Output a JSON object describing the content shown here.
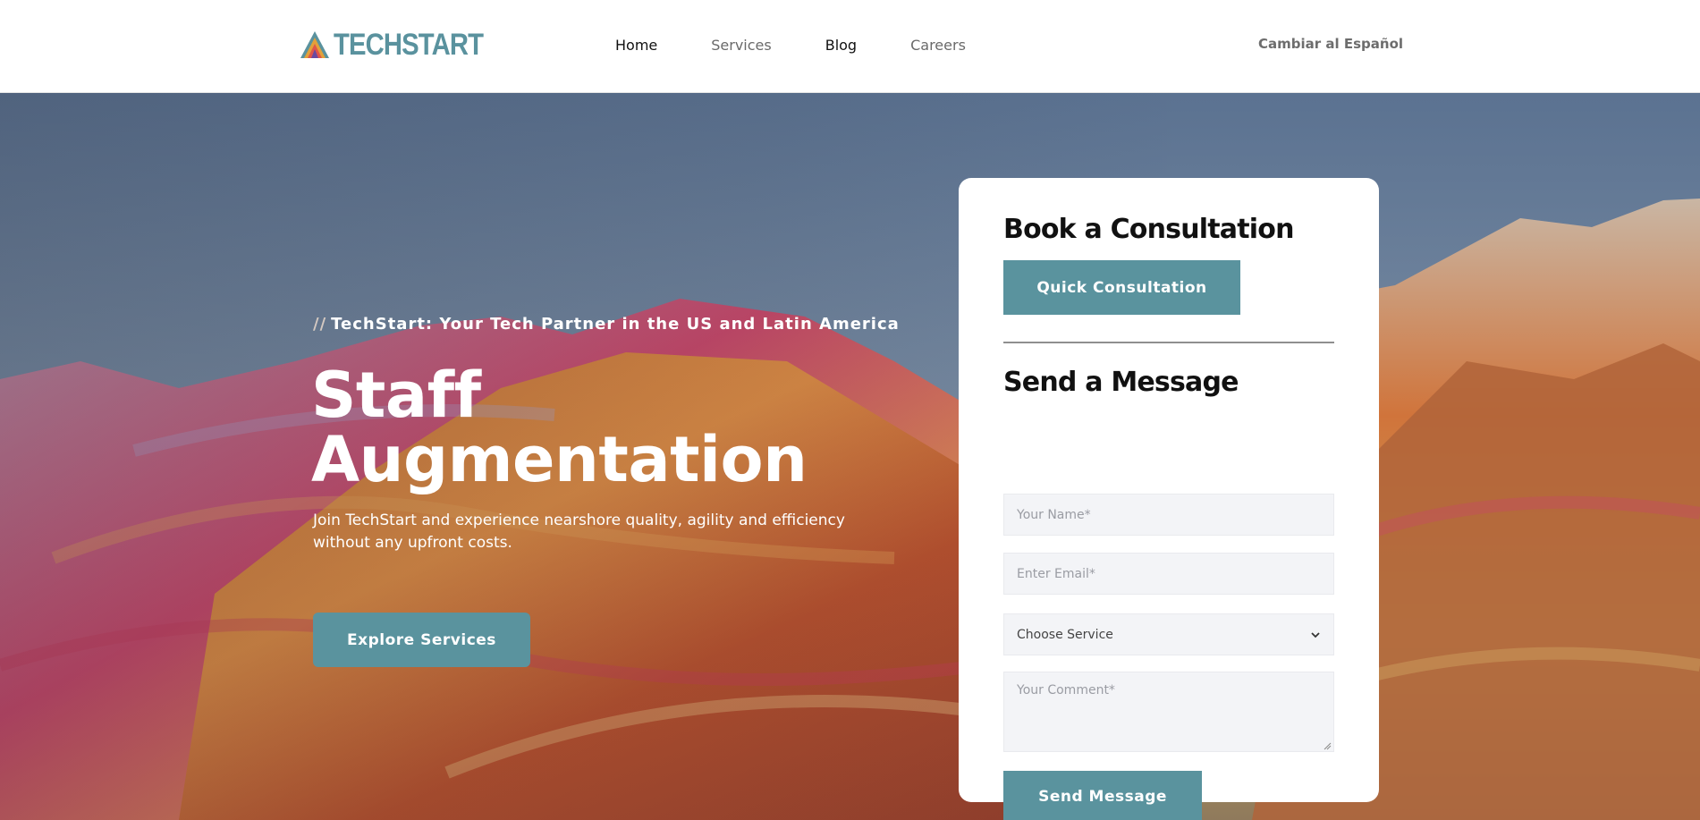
{
  "header": {
    "logo_text": "TECHSTART",
    "nav": [
      {
        "label": "Home",
        "active": true
      },
      {
        "label": "Services",
        "active": false
      },
      {
        "label": "Blog",
        "active": true
      },
      {
        "label": "Careers",
        "active": false
      }
    ],
    "language_link": "Cambiar al Español"
  },
  "hero": {
    "eyebrow_prefix": "//",
    "eyebrow": "TechStart: Your Tech Partner in the US and Latin America",
    "title_line1": "Staff",
    "title_line2": "Augmentation",
    "subtitle": "Join TechStart and experience nearshore quality, agility and efficiency without any upfront costs.",
    "cta_label": "Explore Services",
    "background": "colorful rainbow mountains"
  },
  "form": {
    "book_heading": "Book a Consultation",
    "quick_button": "Quick Consultation",
    "send_heading": "Send a Message",
    "name_placeholder": "Your Name*",
    "email_placeholder": "Enter Email*",
    "service_selected": "Choose Service",
    "comment_placeholder": "Your Comment*",
    "send_button": "Send Message"
  },
  "colors": {
    "accent": "#5a939e",
    "logo": "#5a929e",
    "field_bg": "#f3f4f7",
    "heading": "#111111"
  },
  "icons": {
    "logo": "triangle-logo-icon",
    "select": "chevron-down-icon"
  }
}
